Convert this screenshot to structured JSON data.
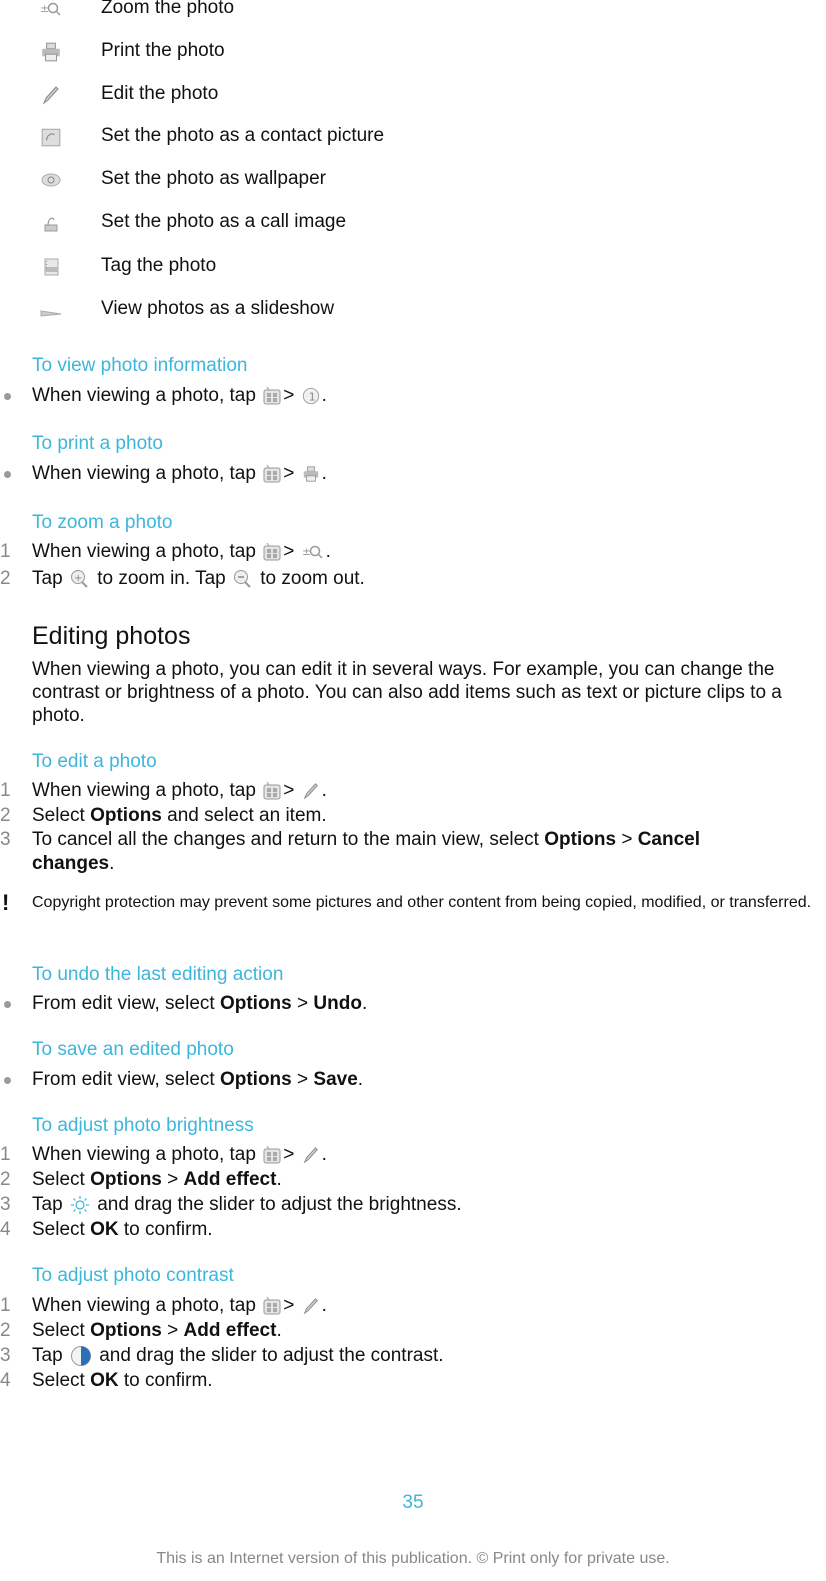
{
  "icon_list": [
    {
      "icon": "zoom-icon",
      "label": "Zoom the photo"
    },
    {
      "icon": "printer-icon",
      "label": "Print the photo"
    },
    {
      "icon": "pencil-icon",
      "label": "Edit the photo"
    },
    {
      "icon": "contact-picture-icon",
      "label": "Set the photo as a contact picture"
    },
    {
      "icon": "wallpaper-icon",
      "label": "Set the photo as wallpaper"
    },
    {
      "icon": "call-image-icon",
      "label": "Set the photo as a call image"
    },
    {
      "icon": "tag-icon",
      "label": "Tag the photo"
    },
    {
      "icon": "slideshow-icon",
      "label": "View photos as a slideshow"
    }
  ],
  "view_info": {
    "heading": "To view photo information",
    "step": {
      "pre": "When viewing a photo, tap",
      "sep": ">",
      "post": "."
    }
  },
  "print": {
    "heading": "To print a photo",
    "step": {
      "pre": "When viewing a photo, tap",
      "sep": ">",
      "post": "."
    }
  },
  "zoom": {
    "heading": "To zoom a photo",
    "steps": [
      {
        "num": "1",
        "pre": "When viewing a photo, tap",
        "sep": ">",
        "post": "."
      },
      {
        "num": "2",
        "a": "Tap",
        "b": "to zoom in. Tap",
        "c": "to zoom out."
      }
    ]
  },
  "editing": {
    "title": "Editing photos",
    "body": "When viewing a photo, you can edit it in several ways. For example, you can change the contrast or brightness of a photo. You can also add items such as text or picture clips to a photo."
  },
  "edit_photo": {
    "heading": "To edit a photo",
    "steps": [
      {
        "num": "1",
        "pre": "When viewing a photo, tap",
        "sep": ">",
        "post": "."
      },
      {
        "num": "2",
        "a": "Select",
        "b": "Options",
        "c": "and select an item."
      },
      {
        "num": "3",
        "a": "To cancel all the changes and return to the main view, select",
        "b": "Options",
        "sep": ">",
        "c": "Cancel",
        "d": "changes",
        "e": "."
      }
    ],
    "note": "Copyright protection may prevent some pictures and other content from being copied, modified, or transferred.",
    "note_mark": "!"
  },
  "undo": {
    "heading": "To undo the last editing action",
    "step": {
      "a": "From edit view, select",
      "b": "Options",
      "sep": ">",
      "c": "Undo",
      "d": "."
    }
  },
  "save": {
    "heading": "To save an edited photo",
    "step": {
      "a": "From edit view, select",
      "b": "Options",
      "sep": ">",
      "c": "Save",
      "d": "."
    }
  },
  "brightness": {
    "heading": "To adjust photo brightness",
    "steps": [
      {
        "num": "1",
        "pre": "When viewing a photo, tap",
        "sep": ">",
        "post": "."
      },
      {
        "num": "2",
        "a": "Select",
        "b": "Options",
        "sep": ">",
        "c": "Add effect",
        "d": "."
      },
      {
        "num": "3",
        "a": "Tap",
        "b": "and drag the slider to adjust the brightness."
      },
      {
        "num": "4",
        "a": "Select",
        "b": "OK",
        "c": "to confirm."
      }
    ]
  },
  "contrast": {
    "heading": "To adjust photo contrast",
    "steps": [
      {
        "num": "1",
        "pre": "When viewing a photo, tap",
        "sep": ">",
        "post": "."
      },
      {
        "num": "2",
        "a": "Select",
        "b": "Options",
        "sep": ">",
        "c": "Add effect",
        "d": "."
      },
      {
        "num": "3",
        "a": "Tap",
        "b": "and drag the slider to adjust the contrast."
      },
      {
        "num": "4",
        "a": "Select",
        "b": "OK",
        "c": "to confirm."
      }
    ]
  },
  "page_number": "35",
  "footer": "This is an Internet version of this publication. © Print only for private use.",
  "colors": {
    "heading": "#3db6dc",
    "text": "#111111",
    "muted": "#888888"
  }
}
